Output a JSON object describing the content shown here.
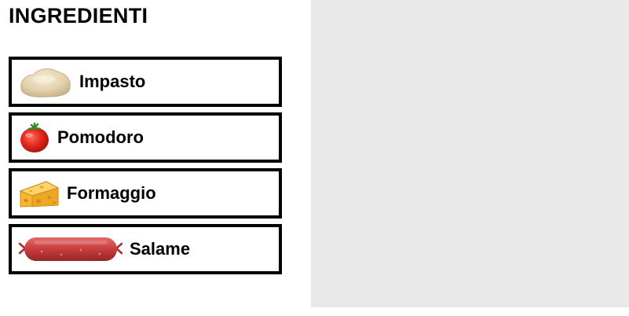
{
  "heading": "INGREDIENTI",
  "ingredients": [
    {
      "label": "Impasto",
      "icon": "dough-icon"
    },
    {
      "label": "Pomodoro",
      "icon": "tomato-icon"
    },
    {
      "label": "Formaggio",
      "icon": "cheese-icon"
    },
    {
      "label": "Salame",
      "icon": "salami-icon"
    }
  ],
  "colors": {
    "card_border": "#000000",
    "drop_zone_background": "#e9e9e9",
    "page_background": "#ffffff"
  }
}
